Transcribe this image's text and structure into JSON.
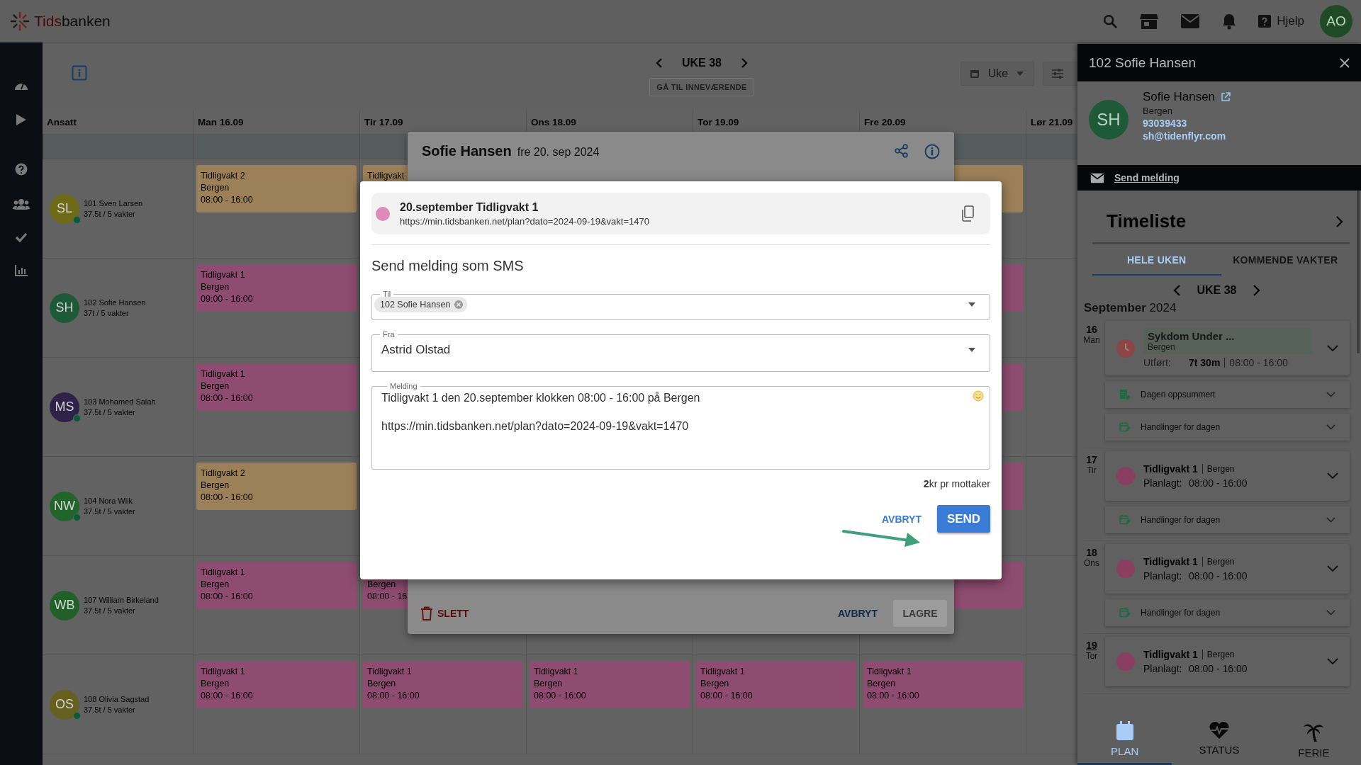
{
  "app": {
    "logo_parts": [
      "Tids",
      "banken"
    ],
    "help": "Hjelp",
    "avatar": "AO"
  },
  "toolbar": {
    "week": "UKE 38",
    "today_button": "GÅ TIL INNEVÆRENDE",
    "view": "Uke"
  },
  "calendar": {
    "columns": [
      "Ansatt",
      "Man 16.09",
      "Tir 17.09",
      "Ons 18.09",
      "Tor 19.09",
      "Fre 20.09",
      "Lør 21.09"
    ],
    "employees": [
      {
        "initials": "SL",
        "name": "101 Sven Larsen",
        "hours": "37.5t / 5 vakter",
        "color": "#6e6a18",
        "online": true,
        "shifts": [
          {
            "kind": "shift",
            "color": "#9c8058",
            "title": "Tidligvakt 2",
            "place": "Bergen",
            "time": "08:00 - 16:00"
          },
          {
            "kind": "shift",
            "color": "#9c8058",
            "title": "Tidligvakt"
          },
          {
            "kind": "none"
          },
          {
            "kind": "none"
          },
          {
            "kind": "shift",
            "color": "#9c8058"
          },
          {
            "kind": "none"
          }
        ]
      },
      {
        "initials": "SH",
        "name": "102 Sofie Hansen",
        "hours": "37t / 5 vakter",
        "color": "#1e5a38",
        "online": false,
        "shifts": [
          {
            "kind": "shift",
            "color": "#8e4c70",
            "title": "Tidligvakt 1",
            "place": "Bergen",
            "time": "09:00 - 16:00"
          },
          {
            "kind": "none"
          },
          {
            "kind": "none"
          },
          {
            "kind": "none"
          },
          {
            "kind": "shift",
            "color": "#8e4c70"
          },
          {
            "kind": "none"
          }
        ]
      },
      {
        "initials": "MS",
        "name": "103 Mohamed Salah",
        "hours": "37.5t / 5 vakter",
        "color": "#2e2248",
        "online": true,
        "shifts": [
          {
            "kind": "shift",
            "color": "#8e4c70",
            "title": "Tidligvakt 1",
            "place": "Bergen",
            "time": "08:00 - 16:00"
          },
          {
            "kind": "none"
          },
          {
            "kind": "none"
          },
          {
            "kind": "none"
          },
          {
            "kind": "shift",
            "color": "#8e4c70"
          },
          {
            "kind": "none"
          }
        ]
      },
      {
        "initials": "NW",
        "name": "104 Nora Wiik",
        "hours": "37.5t / 5 vakter",
        "color": "#22652a",
        "online": true,
        "shifts": [
          {
            "kind": "shift",
            "color": "#9c8058",
            "title": "Tidligvakt 2",
            "place": "Bergen",
            "time": "08:00 - 16:00"
          },
          {
            "kind": "none"
          },
          {
            "kind": "none"
          },
          {
            "kind": "none"
          },
          {
            "kind": "shift",
            "color": "#8e4c70"
          },
          {
            "kind": "none"
          }
        ]
      },
      {
        "initials": "WB",
        "name": "107 William Birkeland",
        "hours": "37.5t / 5 vakter",
        "color": "#22602a",
        "online": false,
        "shifts": [
          {
            "kind": "shift",
            "color": "#8e4c70",
            "title": "Tidligvakt 1",
            "place": "Bergen",
            "time": "08:00 - 16:00"
          },
          {
            "kind": "shift",
            "color": "#8e4c70",
            "place": "Bergen",
            "time": "08:00 - 16"
          },
          {
            "kind": "none"
          },
          {
            "kind": "none"
          },
          {
            "kind": "shift",
            "color": "#8e4c70"
          },
          {
            "kind": "none"
          }
        ]
      },
      {
        "initials": "OS",
        "name": "108 Olivia Sagstad",
        "hours": "37.5t / 5 vakter",
        "color": "#66601e",
        "online": true,
        "shifts": [
          {
            "kind": "shift",
            "color": "#8e4c70",
            "title": "Tidligvakt 1",
            "place": "Bergen",
            "time": "08:00 - 16:00"
          },
          {
            "kind": "shift",
            "color": "#8e4c70",
            "title": "Tidligvakt 1",
            "place": "Bergen",
            "time": "08:00 - 16:00"
          },
          {
            "kind": "shift",
            "color": "#8e4c70",
            "title": "Tidligvakt 1",
            "place": "Bergen",
            "time": "08:00 - 16:00"
          },
          {
            "kind": "shift",
            "color": "#8e4c70",
            "title": "Tidligvakt 1",
            "place": "Bergen",
            "time": "08:00 - 16:00"
          },
          {
            "kind": "shift",
            "color": "#8e4c70",
            "title": "Tidligvakt 1",
            "place": "Bergen",
            "time": "08:00 - 16:00"
          },
          {
            "kind": "none"
          }
        ]
      }
    ]
  },
  "side_panel": {
    "title": "102 Sofie Hansen",
    "initials": "SH",
    "name": "Sofie Hansen",
    "location": "Bergen",
    "phone": "93039433",
    "email": "sh@tidenflyr.com",
    "send_message": "Send melding",
    "timesheet_title": "Timeliste",
    "tabs": [
      {
        "label": "HELE UKEN",
        "selected": true
      },
      {
        "label": "KOMMENDE VAKTER",
        "selected": false
      }
    ],
    "week": "UKE 38",
    "month": "**September** 2024",
    "days": [
      {
        "date": "16",
        "weekday": "Man",
        "today": false,
        "entries": [
          {
            "kind": "absence",
            "title": "Sykdom Under ...",
            "place": "Bergen",
            "label": "Utført:",
            "duration": "7t 30m",
            "time": "08:00 - 16:00"
          },
          {
            "kind": "summary",
            "label": "Dagen oppsummert"
          },
          {
            "kind": "actions",
            "label": "Handlinger for dagen"
          }
        ]
      },
      {
        "date": "17",
        "weekday": "Tir",
        "today": false,
        "entries": [
          {
            "kind": "shift",
            "color": "#8a3e62",
            "title": "Tidligvakt 1",
            "place": "Bergen",
            "label": "Planlagt:",
            "time": "08:00 - 16:00"
          },
          {
            "kind": "actions",
            "label": "Handlinger for dagen"
          }
        ]
      },
      {
        "date": "18",
        "weekday": "Ons",
        "today": false,
        "entries": [
          {
            "kind": "shift",
            "color": "#8a3e62",
            "title": "Tidligvakt 1",
            "place": "Bergen",
            "label": "Planlagt:",
            "time": "08:00 - 16:00"
          },
          {
            "kind": "actions",
            "label": "Handlinger for dagen"
          }
        ]
      },
      {
        "date": "19",
        "weekday": "Tor",
        "today": true,
        "entries": [
          {
            "kind": "shift",
            "color": "#8a3e62",
            "title": "Tidligvakt 1",
            "place": "Bergen",
            "label": "Planlagt:",
            "time": "08:00 - 16:00"
          }
        ]
      }
    ],
    "nav": [
      {
        "kind": "calendar",
        "label": "PLAN",
        "selected": true
      },
      {
        "kind": "heart",
        "label": "STATUS",
        "selected": false
      },
      {
        "kind": "palm",
        "label": "FERIE",
        "selected": false
      }
    ]
  },
  "shift_dialog": {
    "name": "Sofie Hansen",
    "date": "fre 20. sep 2024",
    "delete": "SLETT",
    "cancel": "AVBRYT",
    "save": "LAGRE",
    "save_disabled": true
  },
  "sms_dialog": {
    "link": {
      "color": "#e08ab8",
      "title": "20.september Tidligvakt 1",
      "url": "https://min.tidsbanken.net/plan?dato=2024-09-19&vakt=1470"
    },
    "heading": "Send melding som SMS",
    "to": {
      "label": "Til",
      "chips": [
        "102 Sofie Hansen"
      ]
    },
    "from": {
      "label": "Fra",
      "value": "Astrid Olstad"
    },
    "message": {
      "label": "Melding",
      "paragraphs": [
        "Tidligvakt 1 den 20.september klokken 08:00 - 16:00 på Bergen",
        "https://min.tidsbanken.net/plan?dato=2024-09-19&vakt=1470"
      ]
    },
    "price": "**2**kr pr mottaker",
    "cancel": "AVBRYT",
    "send": "SEND"
  }
}
